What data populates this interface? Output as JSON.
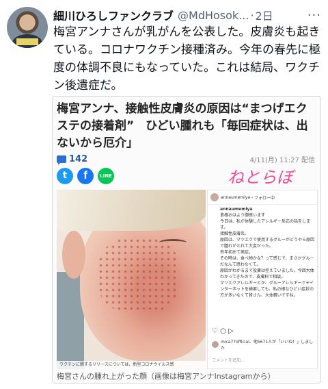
{
  "tweet": {
    "author_name": "細川ひろしファンクラブ",
    "handle": "@MdHosok...",
    "separator": "·",
    "time": "2日",
    "more": "···",
    "text": "梅宮アンナさんが乳がんを公表した。皮膚炎も起きている。コロナワクチン接種済み。今年の春先に極度の体調不良にもなっていた。これは結局、ワクチン後遺症だ。"
  },
  "article": {
    "title": "梅宮アンナ、接触性皮膚炎の原因は“まつげエクステの接着剤”　ひどい腫れも「毎回症状は、出ないから厄介」",
    "comment_count": "142",
    "date": "4/11(月) 11:27 配信",
    "brand": "ねとらぼ",
    "share_icons": [
      "twitter-icon",
      "facebook-icon",
      "line-icon"
    ],
    "share_labels": {
      "twitter": "t",
      "facebook": "f",
      "line": "LINE"
    },
    "photo_caption": "ワクチンに関するリリースについては、新型コロナウイルス感",
    "caption": "梅宮さんの腫れ上がった顔（画像は梅宮アンナInstagramから）",
    "instagram": {
      "account": "annaumemiya",
      "follow": "・フォロー中",
      "caption": "皆様おはよう御座います\n今日は、私が体験したアレルギー反応の話をします。\n接触性皮膚炎。\n原因は、マツエクで使用するグルーがどうやら原因で腫れがとれて大変だった。\n去年初めて発症。\nその時は、食べ物かな？って感じで、まさかグルーだなんて思わなくて。\n原因がわかるまで投薬は控えていました。今回大体わかってきたので、皮膚科で相談。\nマツエクアレルギーとか、グルーアレルギーでテインターネットを検索しても、私の様なひどい症状の方が多いなくて皆さん、大体軽いですね。",
      "actions": "♡ ○ ▷",
      "liked_by": "mica77official、他5671人が「いいね！」しました",
      "comment_placeholder": "コメントを追加..."
    }
  }
}
